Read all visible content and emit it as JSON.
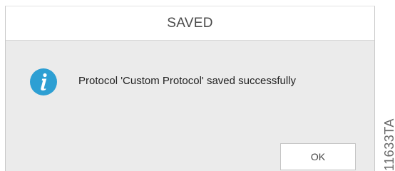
{
  "dialog": {
    "title": "SAVED",
    "message": "Protocol 'Custom Protocol' saved successfully",
    "icon": "info-icon",
    "ok_label": "OK"
  },
  "side_label": "11633TA",
  "colors": {
    "icon_blue": "#2d9fd3",
    "body_bg": "#ebebeb",
    "title_bg": "#ffffff"
  }
}
